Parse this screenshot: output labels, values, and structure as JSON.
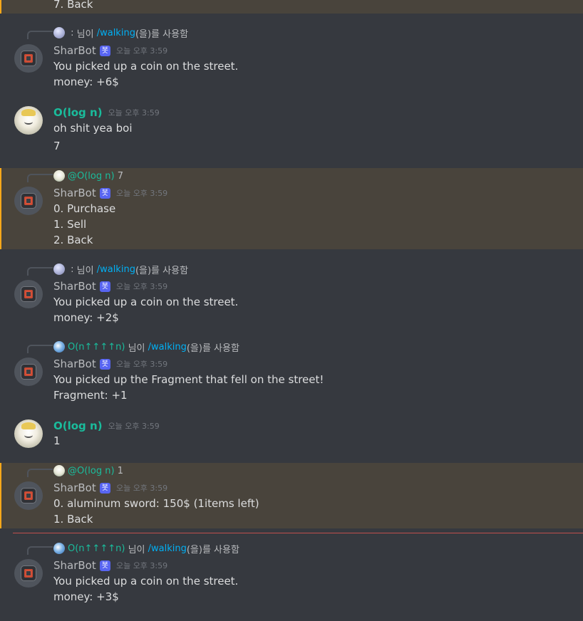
{
  "bot_name": "SharBot",
  "bot_badge": "봇",
  "user_name": "O(log n)",
  "timestamp": "오늘 오후 3:59",
  "top_partial": {
    "text": "7. Back"
  },
  "m1": {
    "reply_sep": " : ",
    "reply_name": "님이",
    "reply_cmd": "/walking",
    "reply_tail": "(을)를 사용함",
    "lines": [
      "You picked up a coin on the street.",
      "money: +6$"
    ]
  },
  "m2": {
    "lines": [
      "oh shit yea boi",
      "7"
    ]
  },
  "m3": {
    "reply_mention": "@O(log n)",
    "reply_text": " 7",
    "lines": [
      "0. Purchase",
      "1. Sell",
      "2. Back"
    ]
  },
  "m4": {
    "reply_sep": " : ",
    "reply_name": "님이",
    "reply_cmd": "/walking",
    "reply_tail": "(을)를 사용함",
    "lines": [
      "You picked up a coin on the street.",
      "money: +2$"
    ]
  },
  "m5": {
    "reply_user": "O(n↑↑↑↑n)",
    "reply_name": " 님이 ",
    "reply_cmd": "/walking",
    "reply_tail": "(을)를 사용함",
    "lines": [
      "You picked up the Fragment that fell on the street!",
      "Fragment: +1"
    ]
  },
  "m6": {
    "lines": [
      "1"
    ]
  },
  "m7": {
    "reply_mention": "@O(log n)",
    "reply_text": " 1",
    "lines": [
      "0. aluminum sword: 150$ (1items left)",
      "1. Back"
    ]
  },
  "m8": {
    "reply_user": "O(n↑↑↑↑n)",
    "reply_name": " 님이 ",
    "reply_cmd": "/walking",
    "reply_tail": "(을)를 사용함",
    "lines": [
      "You picked up a coin on the street.",
      "money: +3$"
    ]
  }
}
